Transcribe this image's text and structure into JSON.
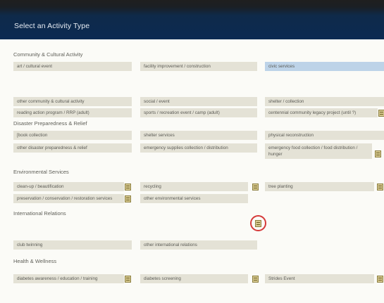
{
  "window": {
    "title": "Select an Activity Type"
  },
  "sections": {
    "community": "Community & Cultural Activity",
    "disaster": "Disaster Preparedness & Relief",
    "environment": "Environmental Services",
    "international": "International Relations",
    "health": "Health & Wellness"
  },
  "options": {
    "c1": "art / cultural event",
    "c2": "facility improvement / construction",
    "c3": "civic services",
    "c4": "other community & cultural activity",
    "c5": "social / event",
    "c6": "shelter / collection",
    "c7": "reading action program / RRP (adult)",
    "c8": "sports / recreation event / camp (adult)",
    "c9": "centennial community legacy project (until ?)",
    "d1": "[book collection",
    "d2": "shelter services",
    "d3": "physical reconstruction",
    "d4": "other disaster preparedness & relief",
    "d5": "emergency supplies collection / distribution",
    "d6": "emergency food collection / food distribution / hunger",
    "e1": "clean-up / beautification",
    "e2": "recycling",
    "e3": "tree planting",
    "e4": "preservation / conservation / restoration services",
    "e5": "other environmental services",
    "i1": "club twinning",
    "i2": "other international relations",
    "h1": "diabetes awareness / education / training",
    "h2": "diabetes screening",
    "h3": "Strides Event"
  }
}
